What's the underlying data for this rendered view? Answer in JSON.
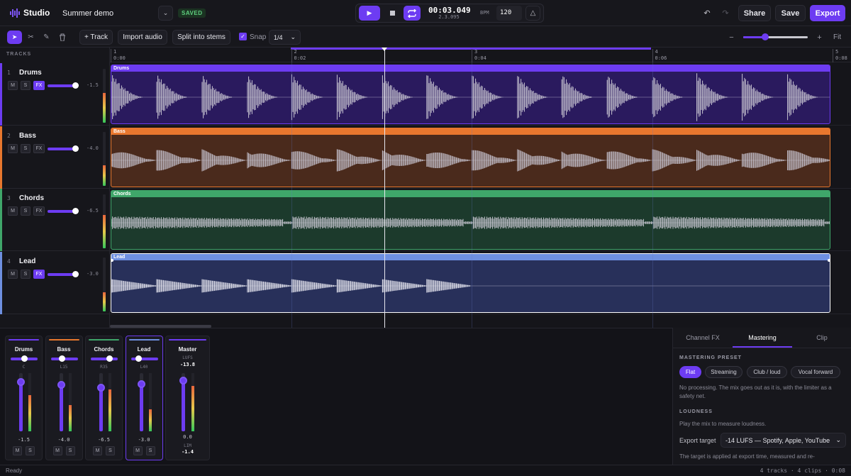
{
  "app": {
    "name": "Studio",
    "project_title": "Summer demo",
    "save_status": "SAVED"
  },
  "transport": {
    "time": "00:03.049",
    "bars_beats": "2.3.095",
    "bpm_label": "BPM",
    "bpm": "120"
  },
  "actions": {
    "share": "Share",
    "save": "Save",
    "export": "Export"
  },
  "toolbar": {
    "add_track": "+ Track",
    "import_audio": "Import audio",
    "split_stems": "Split into stems",
    "snap_label": "Snap",
    "snap_value": "1/4",
    "fit": "Fit",
    "zoom_level": 0.85
  },
  "tracks_header": "TRACKS",
  "ruler": [
    {
      "bar": "1",
      "time": "0:00"
    },
    {
      "bar": "2",
      "time": "0:02"
    },
    {
      "bar": "3",
      "time": "0:04"
    },
    {
      "bar": "4",
      "time": "0:06"
    },
    {
      "bar": "5",
      "time": "0:08"
    }
  ],
  "tracks": [
    {
      "num": "1",
      "name": "Drums",
      "color": "#6d3cf2",
      "clip_color": "#2a1a5e",
      "header_color": "#6d3cf2",
      "volume": "-1.5",
      "fx_active": true,
      "level": 0.55,
      "wave": "drum"
    },
    {
      "num": "2",
      "name": "Bass",
      "color": "#e8772e",
      "clip_color": "#4a2a1c",
      "header_color": "#e8772e",
      "volume": "-4.0",
      "fx_active": false,
      "level": 0.38,
      "wave": "bass"
    },
    {
      "num": "3",
      "name": "Chords",
      "color": "#3fa66a",
      "clip_color": "#1c3a2c",
      "header_color": "#3fa66a",
      "volume": "-6.5",
      "fx_active": false,
      "level": 0.62,
      "wave": "pad"
    },
    {
      "num": "4",
      "name": "Lead",
      "color": "#6e8fe0",
      "clip_color": "#28305a",
      "header_color": "#6e8fe0",
      "volume": "-3.0",
      "fx_active": true,
      "level": 0.35,
      "wave": "lead"
    }
  ],
  "track_buttons": {
    "mute": "M",
    "solo": "S",
    "fx": "FX"
  },
  "mixer": [
    {
      "name": "Drums",
      "color": "#6d3cf2",
      "pan": "C",
      "pan_pos": 0.5,
      "fader": 0.85,
      "level": 0.62,
      "value": "-1.5"
    },
    {
      "name": "Bass",
      "color": "#e8772e",
      "pan": "L15",
      "pan_pos": 0.42,
      "fader": 0.8,
      "level": 0.45,
      "value": "-4.0"
    },
    {
      "name": "Chords",
      "color": "#3fa66a",
      "pan": "R35",
      "pan_pos": 0.7,
      "fader": 0.76,
      "level": 0.72,
      "value": "-6.5"
    },
    {
      "name": "Lead",
      "color": "#6e8fe0",
      "pan": "L40",
      "pan_pos": 0.3,
      "fader": 0.82,
      "level": 0.38,
      "value": "-3.0",
      "selected": true
    }
  ],
  "master": {
    "name": "Master",
    "lufs_label": "LUFS",
    "lufs": "-13.8",
    "value": "0.0",
    "lim_label": "LIM",
    "lim": "-1.4",
    "fader": 0.88,
    "level": 0.78
  },
  "panel": {
    "tabs": [
      "Channel FX",
      "Mastering",
      "Clip"
    ],
    "active_tab": "Mastering",
    "preset_header": "MASTERING PRESET",
    "presets": [
      "Flat",
      "Streaming",
      "Club / loud",
      "Vocal forward"
    ],
    "preset_desc": "No processing. The mix goes out as it is, with the limiter as a safety net.",
    "loudness_header": "LOUDNESS",
    "loudness_hint": "Play the mix to measure loudness.",
    "export_target_label": "Export target",
    "export_target_value": "-14 LUFS — Spotify, Apple, YouTube",
    "export_note": "The target is applied at export time, measured and re-"
  },
  "status": {
    "left": "Ready",
    "right": "4 tracks · 4 clips · 0:08"
  }
}
